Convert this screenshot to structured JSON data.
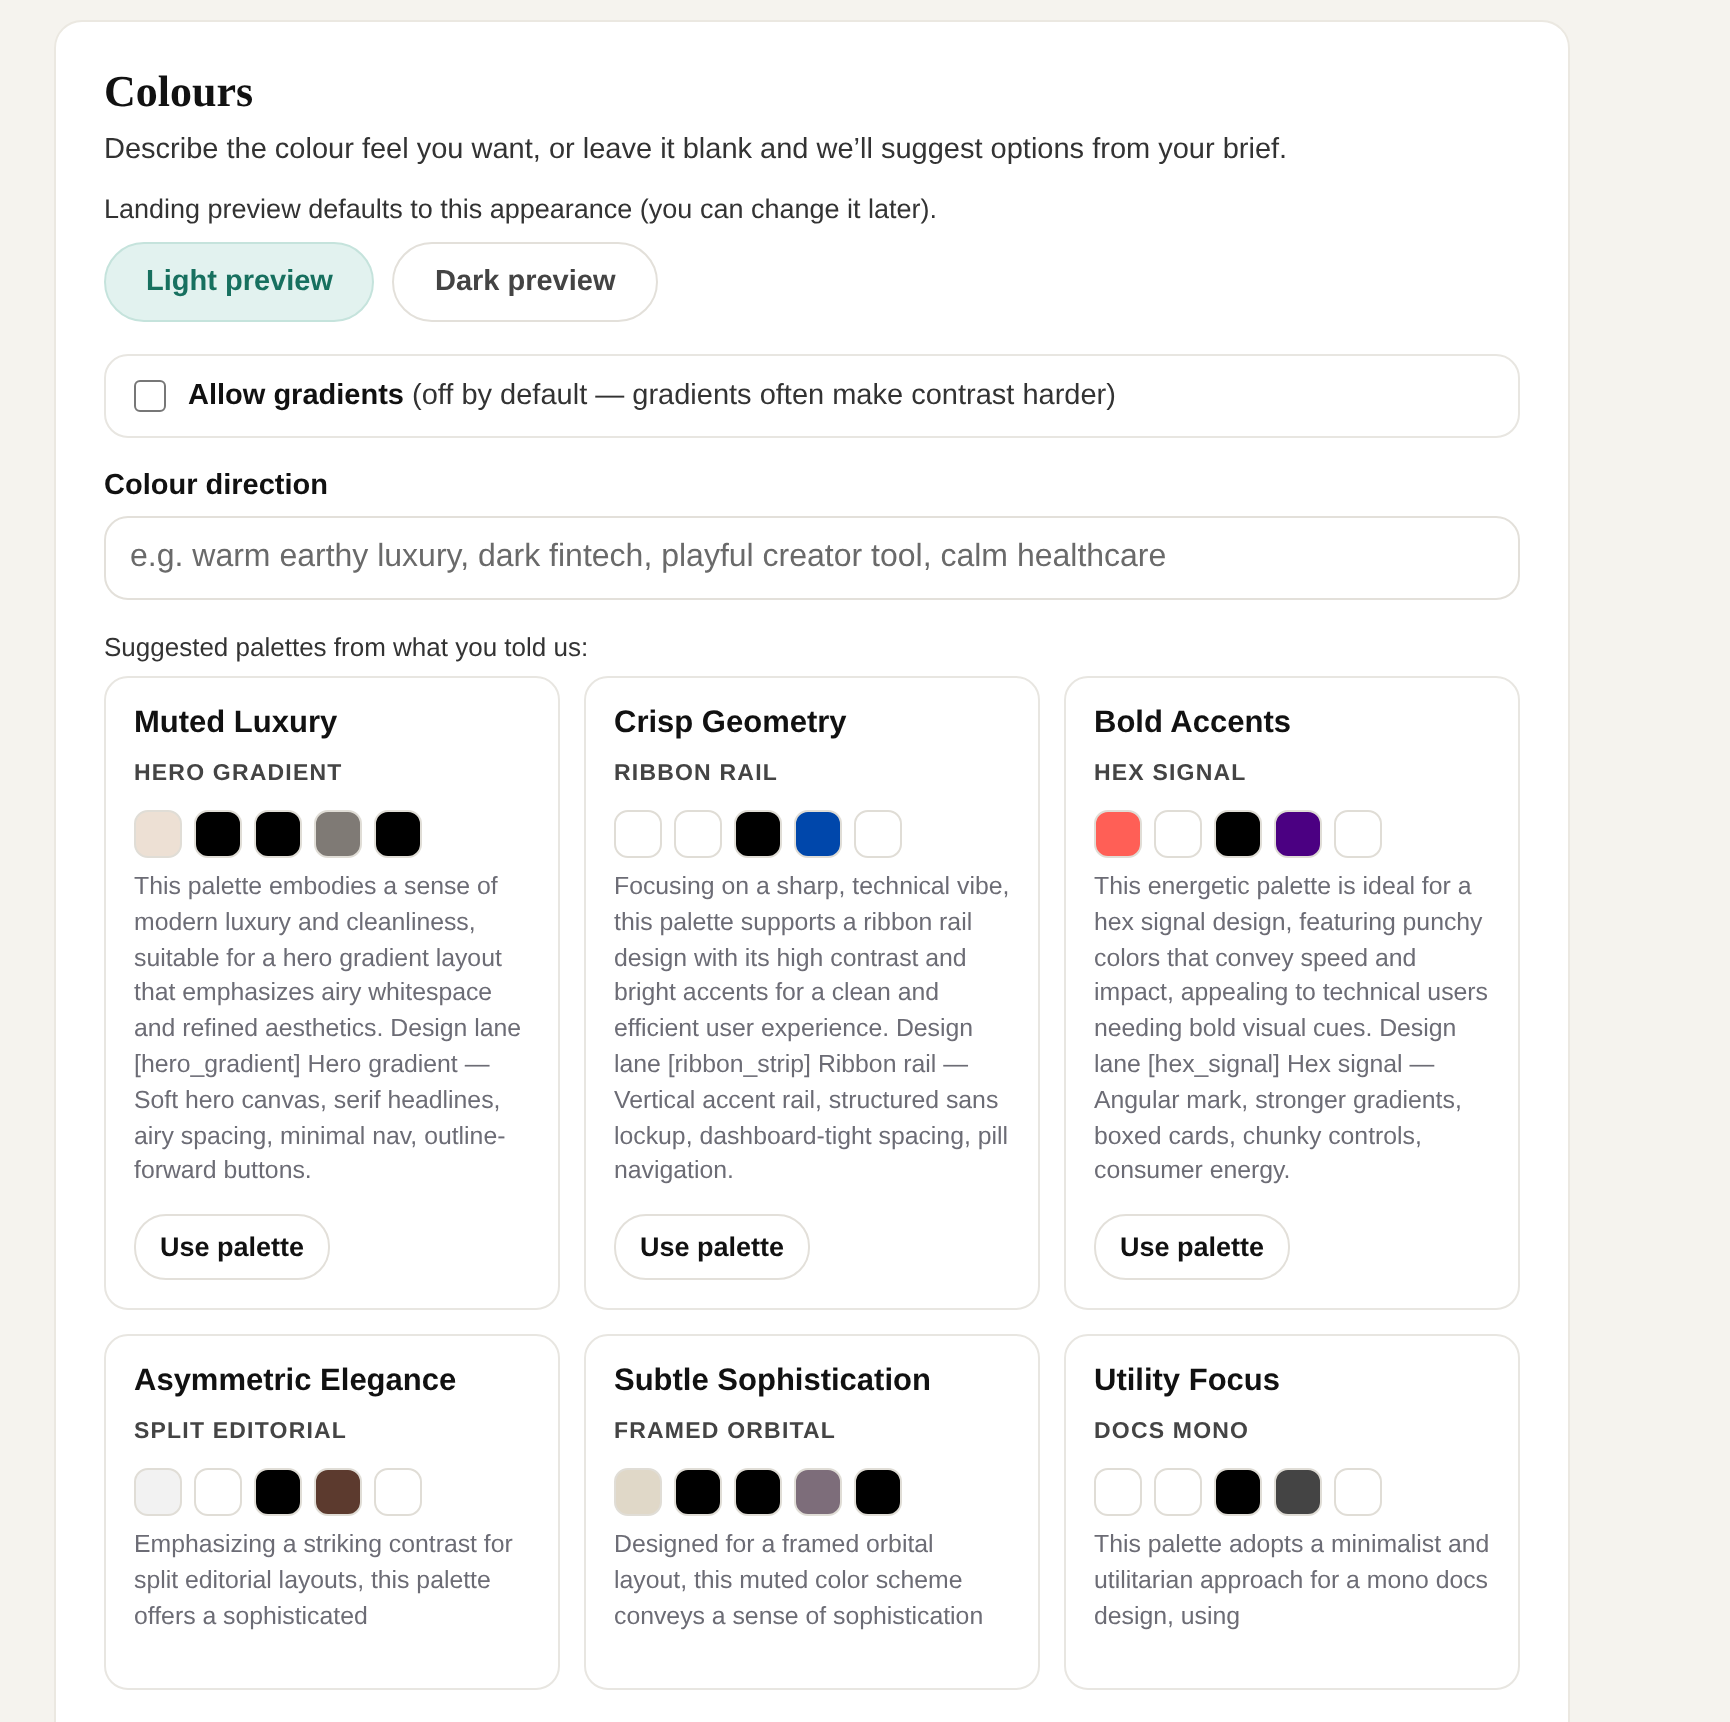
{
  "title": "Colours",
  "intro": "Describe the colour feel you want, or leave it blank and we’ll suggest options from your brief.",
  "appearance_note": "Landing preview defaults to this appearance (you can change it later).",
  "preview_tabs": [
    {
      "label": "Light preview",
      "selected": true
    },
    {
      "label": "Dark preview",
      "selected": false
    }
  ],
  "gradients": {
    "label": "**Allow gradients** (off by default — gradients often make contrast harder)",
    "checked": false
  },
  "direction": {
    "label": "Colour direction",
    "placeholder": "e.g. warm earthy luxury, dark fintech, playful creator tool, calm healthcare"
  },
  "suggest_note": "Suggested palettes from what you told us:",
  "palettes": [
    {
      "name": "Muted Luxury",
      "lane": "HERO GRADIENT",
      "swatches": [
        {
          "color": "#ede0d4"
        },
        {
          "color": "#000000"
        },
        {
          "color": "#000000"
        },
        {
          "color": "#7f7a75"
        },
        {
          "color": "#000000"
        }
      ],
      "description": "This palette embodies a sense of modern luxury and cleanliness, suitable for a hero gradient layout that emphasizes airy whitespace and refined aesthetics. Design lane [hero_gradient] Hero gradient — Soft hero canvas, serif headlines, airy spacing, minimal nav, outline-forward buttons.",
      "button": "Use palette"
    },
    {
      "name": "Crisp Geometry",
      "lane": "RIBBON RAIL",
      "swatches": [
        {
          "color": "#ffffff"
        },
        {
          "color": "#ffffff"
        },
        {
          "color": "#000000"
        },
        {
          "color": "#0047ab"
        },
        {
          "color": "#ffffff"
        }
      ],
      "description": "Focusing on a sharp, technical vibe, this palette supports a ribbon rail design with its high contrast and bright accents for a clean and efficient user experience. Design lane [ribbon_strip] Ribbon rail — Vertical accent rail, structured sans lockup, dashboard-tight spacing, pill navigation.",
      "button": "Use palette"
    },
    {
      "name": "Bold Accents",
      "lane": "HEX SIGNAL",
      "swatches": [
        {
          "color": "#ff5f56"
        },
        {
          "color": "#ffffff"
        },
        {
          "color": "#000000"
        },
        {
          "color": "#4b0082"
        },
        {
          "color": "#ffffff"
        }
      ],
      "description": "This energetic palette is ideal for a hex signal design, featuring punchy colors that convey speed and impact, appealing to technical users needing bold visual cues. Design lane [hex_signal] Hex signal — Angular mark, stronger gradients, boxed cards, chunky controls, consumer energy.",
      "button": "Use palette"
    },
    {
      "name": "Asymmetric Elegance",
      "lane": "SPLIT EDITORIAL",
      "swatches": [
        {
          "color": "#f2f2f2"
        },
        {
          "color": "#ffffff"
        },
        {
          "color": "#000000"
        },
        {
          "color": "#5c3a2e"
        },
        {
          "color": "#ffffff"
        }
      ],
      "description": "Emphasizing a striking contrast for split editorial layouts, this palette offers a sophisticated"
    },
    {
      "name": "Subtle Sophistication",
      "lane": "FRAMED ORBITAL",
      "swatches": [
        {
          "color": "#e0d8c8"
        },
        {
          "color": "#000000"
        },
        {
          "color": "#000000"
        },
        {
          "color": "#7d6d7a"
        },
        {
          "color": "#000000"
        }
      ],
      "description": "Designed for a framed orbital layout, this muted color scheme conveys a sense of sophistication"
    },
    {
      "name": "Utility Focus",
      "lane": "DOCS MONO",
      "swatches": [
        {
          "color": "#ffffff"
        },
        {
          "color": "#ffffff"
        },
        {
          "color": "#000000"
        },
        {
          "color": "#444444"
        },
        {
          "color": "#ffffff"
        }
      ],
      "description": "This palette adopts a minimalist and utilitarian approach for a mono docs design, using"
    }
  ]
}
